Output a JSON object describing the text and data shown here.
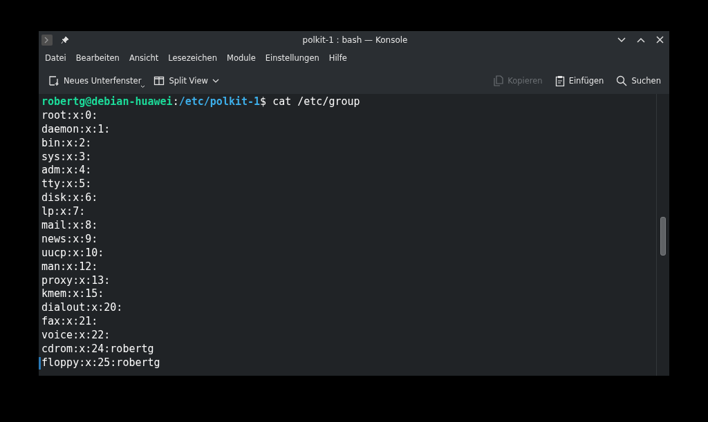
{
  "window": {
    "title": "polkit-1 : bash — Konsole"
  },
  "menu": [
    "Datei",
    "Bearbeiten",
    "Ansicht",
    "Lesezeichen",
    "Module",
    "Einstellungen",
    "Hilfe"
  ],
  "toolbar_left": [
    {
      "kind": "new-tab",
      "label": "Neues Unterfenster",
      "disabled": false
    },
    {
      "kind": "split",
      "label": "Split View",
      "disabled": false
    }
  ],
  "toolbar_right": [
    {
      "kind": "copy",
      "label": "Kopieren",
      "disabled": true
    },
    {
      "kind": "paste",
      "label": "Einfügen",
      "disabled": false
    },
    {
      "kind": "search",
      "label": "Suchen",
      "disabled": false
    }
  ],
  "terminal": {
    "prompt_user": "robertg@debian-huawei",
    "prompt_sep": ":",
    "prompt_path": "/etc/polkit-1",
    "prompt_end": "$ ",
    "command": "cat /etc/group",
    "lines": [
      "root:x:0:",
      "daemon:x:1:",
      "bin:x:2:",
      "sys:x:3:",
      "adm:x:4:",
      "tty:x:5:",
      "disk:x:6:",
      "lp:x:7:",
      "mail:x:8:",
      "news:x:9:",
      "uucp:x:10:",
      "man:x:12:",
      "proxy:x:13:",
      "kmem:x:15:",
      "dialout:x:20:",
      "fax:x:21:",
      "voice:x:22:",
      "cdrom:x:24:robertg",
      "floppy:x:25:robertg"
    ]
  }
}
